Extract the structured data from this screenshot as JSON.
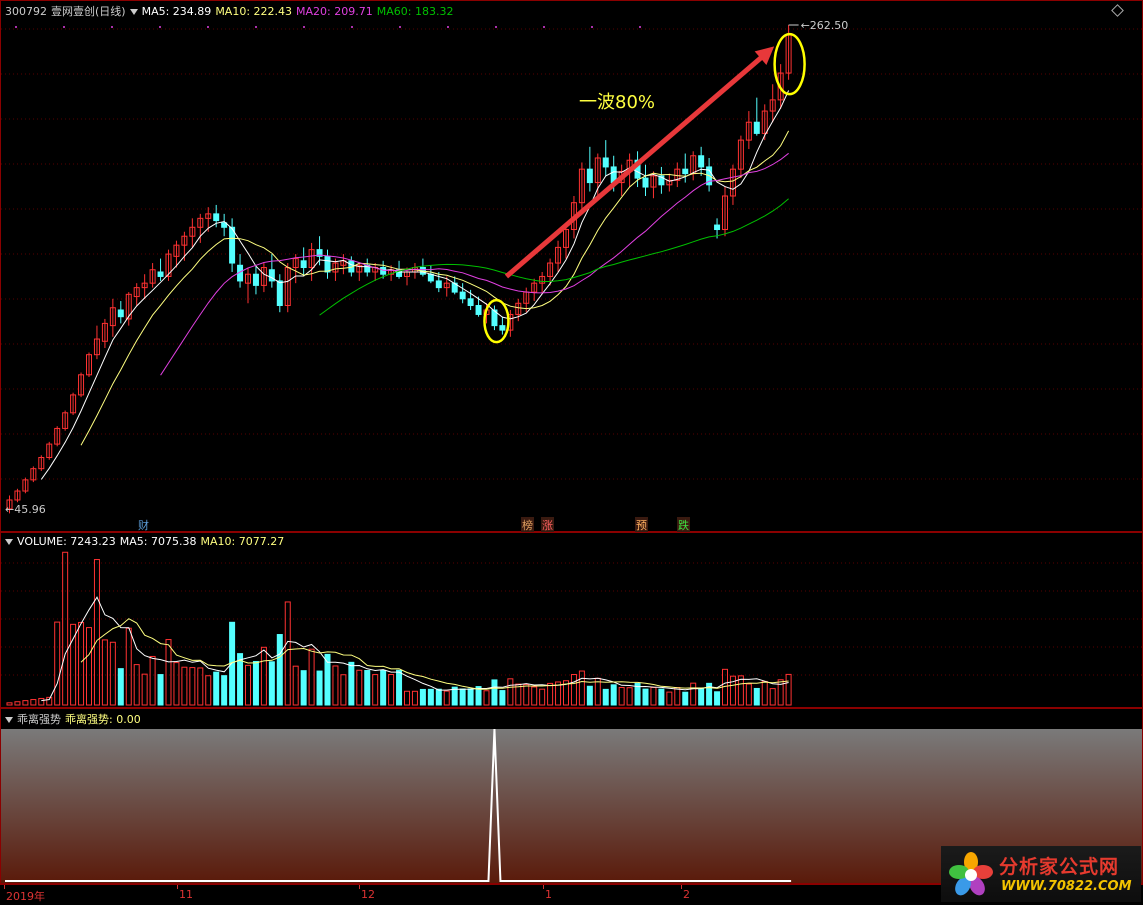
{
  "main": {
    "code": "300792",
    "name": "壹网壹创(日线)",
    "ma5": "MA5: 234.89",
    "ma10": "MA10: 222.43",
    "ma20": "MA20: 209.71",
    "ma60": "MA60: 183.32",
    "high_label": "262.50",
    "low_label": "45.96",
    "annotation": "一波80%",
    "colors": {
      "up": "#ff3232",
      "down": "#54ffff",
      "ma5": "#ffffff",
      "ma10": "#ffff80",
      "ma20": "#e040e0",
      "ma60": "#00c000",
      "arrow": "#e8383a",
      "circle": "#ffff00"
    }
  },
  "events": [
    {
      "label": "财",
      "color": "#5b9bd5"
    },
    {
      "label": "榜",
      "color": "#e0a060"
    },
    {
      "label": "涨",
      "color": "#ff6060"
    },
    {
      "label": "预",
      "color": "#ffb060"
    },
    {
      "label": "跌",
      "color": "#40e040"
    }
  ],
  "volume": {
    "title": "VOLUME: 7243.23",
    "ma5": "MA5: 7075.38",
    "ma10": "MA10: 7077.27"
  },
  "indicator": {
    "name": "乖离强势",
    "value_label": "乖离强势: 0.00"
  },
  "xaxis": {
    "labels": [
      "2019年",
      "11",
      "12",
      "1",
      "2"
    ]
  },
  "logo": {
    "title": "分析家公式网",
    "url": "WWW.70822.COM"
  },
  "chart_data": {
    "type": "candlestick",
    "price_range": [
      45.96,
      262.5
    ],
    "candles": [
      [
        46,
        52,
        44,
        50
      ],
      [
        50,
        55,
        49,
        54
      ],
      [
        54,
        60,
        53,
        59
      ],
      [
        59,
        65,
        58,
        64
      ],
      [
        64,
        70,
        63,
        69
      ],
      [
        69,
        76,
        68,
        75
      ],
      [
        75,
        83,
        74,
        82
      ],
      [
        82,
        90,
        81,
        89
      ],
      [
        89,
        98,
        88,
        97
      ],
      [
        97,
        107,
        96,
        106
      ],
      [
        106,
        116,
        105,
        115
      ],
      [
        115,
        128,
        113,
        122
      ],
      [
        121,
        131,
        118,
        129
      ],
      [
        128,
        140,
        123,
        136
      ],
      [
        135,
        139,
        129,
        132
      ],
      [
        131,
        143,
        128,
        142
      ],
      [
        141,
        147,
        137,
        145
      ],
      [
        145,
        151,
        140,
        147
      ],
      [
        147,
        156,
        145,
        153
      ],
      [
        152,
        158,
        148,
        150
      ],
      [
        150,
        162,
        148,
        160
      ],
      [
        159,
        166,
        154,
        164
      ],
      [
        164,
        170,
        157,
        168
      ],
      [
        168,
        176,
        163,
        172
      ],
      [
        172,
        178,
        165,
        176
      ],
      [
        176,
        181,
        170,
        178
      ],
      [
        178,
        182,
        172,
        175
      ],
      [
        174,
        178,
        168,
        172
      ],
      [
        172,
        176,
        152,
        156
      ],
      [
        155,
        160,
        145,
        148
      ],
      [
        147,
        154,
        138,
        151
      ],
      [
        151,
        155,
        142,
        146
      ],
      [
        146,
        156,
        143,
        154
      ],
      [
        153,
        160,
        145,
        148
      ],
      [
        148,
        151,
        134,
        137
      ],
      [
        137,
        156,
        134,
        154
      ],
      [
        154,
        160,
        147,
        158
      ],
      [
        157,
        163,
        150,
        154
      ],
      [
        154,
        165,
        148,
        162
      ],
      [
        162,
        168,
        155,
        159
      ],
      [
        159,
        162,
        149,
        152
      ],
      [
        152,
        158,
        148,
        156
      ],
      [
        155,
        160,
        151,
        157
      ],
      [
        157,
        159,
        150,
        152
      ],
      [
        152,
        156,
        148,
        155
      ],
      [
        155,
        158,
        150,
        152
      ],
      [
        152,
        156,
        148,
        154
      ],
      [
        154,
        157,
        149,
        151
      ],
      [
        151,
        155,
        148,
        153
      ],
      [
        153,
        157,
        149,
        150
      ],
      [
        150,
        154,
        146,
        152
      ],
      [
        152,
        156,
        149,
        154
      ],
      [
        154,
        158,
        150,
        151
      ],
      [
        151,
        155,
        147,
        148
      ],
      [
        148,
        152,
        143,
        145
      ],
      [
        145,
        150,
        141,
        147
      ],
      [
        147,
        150,
        142,
        143
      ],
      [
        143,
        147,
        138,
        140
      ],
      [
        140,
        144,
        135,
        137
      ],
      [
        137,
        141,
        132,
        133
      ],
      [
        133,
        138,
        129,
        135
      ],
      [
        135,
        137,
        126,
        128
      ],
      [
        128,
        132,
        124,
        126
      ],
      [
        126,
        135,
        123,
        133
      ],
      [
        133,
        140,
        130,
        138
      ],
      [
        138,
        145,
        134,
        143
      ],
      [
        143,
        149,
        139,
        147
      ],
      [
        147,
        152,
        142,
        150
      ],
      [
        150,
        158,
        146,
        156
      ],
      [
        156,
        166,
        152,
        163
      ],
      [
        163,
        174,
        158,
        171
      ],
      [
        171,
        186,
        167,
        183
      ],
      [
        183,
        201,
        178,
        198
      ],
      [
        198,
        208,
        188,
        192
      ],
      [
        192,
        205,
        185,
        203
      ],
      [
        203,
        211,
        195,
        199
      ],
      [
        199,
        204,
        188,
        192
      ],
      [
        192,
        200,
        186,
        197
      ],
      [
        197,
        205,
        190,
        202
      ],
      [
        202,
        206,
        190,
        194
      ],
      [
        194,
        200,
        186,
        190
      ],
      [
        190,
        197,
        185,
        195
      ],
      [
        195,
        199,
        187,
        191
      ],
      [
        191,
        196,
        188,
        193
      ],
      [
        193,
        201,
        190,
        198
      ],
      [
        198,
        205,
        192,
        196
      ],
      [
        196,
        206,
        193,
        204
      ],
      [
        204,
        208,
        195,
        199
      ],
      [
        199,
        203,
        188,
        191
      ],
      [
        173,
        176,
        167,
        171
      ],
      [
        171,
        190,
        168,
        186
      ],
      [
        186,
        200,
        182,
        198
      ],
      [
        198,
        213,
        194,
        211
      ],
      [
        211,
        224,
        207,
        219
      ],
      [
        219,
        230,
        213,
        214
      ],
      [
        214,
        227,
        211,
        224
      ],
      [
        224,
        236,
        219,
        229
      ],
      [
        229,
        245,
        225,
        241
      ],
      [
        241,
        262.5,
        238,
        258
      ]
    ],
    "volume_range": [
      0,
      22000
    ]
  }
}
